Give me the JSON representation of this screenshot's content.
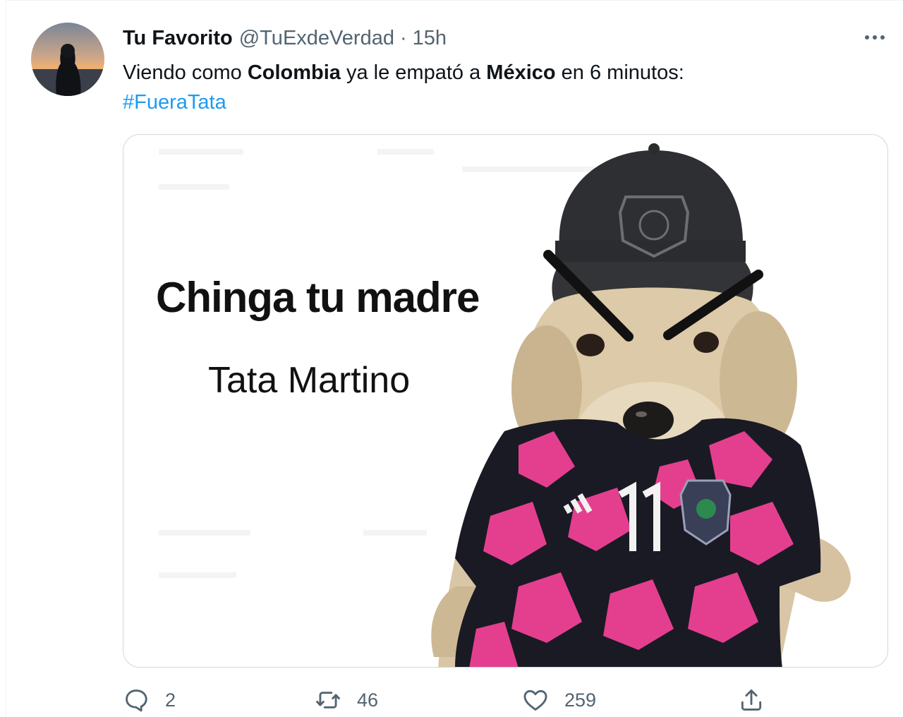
{
  "tweet": {
    "author_name": "Tu Favorito",
    "handle": "@TuExdeVerdad",
    "separator": "·",
    "time": "15h",
    "text_parts": [
      "Viendo como ",
      "Colombia",
      " ya le empató a ",
      "México",
      " en 6 minutos:"
    ],
    "hashtag": "#FueraTata"
  },
  "media": {
    "meme_title": "Chinga tu madre",
    "meme_subtitle": "Tata Martino",
    "jersey_number": "11",
    "jersey_brand": "adidas"
  },
  "actions": {
    "reply_count": "2",
    "retweet_count": "46",
    "like_count": "259"
  },
  "icons": {
    "reply": "reply-icon",
    "retweet": "retweet-icon",
    "like": "heart-icon",
    "share": "share-icon",
    "more": "more-icon"
  },
  "colors": {
    "link": "#1d9bf0",
    "secondary_text": "#536471",
    "primary_text": "#0f1419",
    "border": "#cfd9de",
    "jersey_pink": "#e43f8f",
    "jersey_black": "#1a1a24",
    "cap": "#2e2f33"
  }
}
